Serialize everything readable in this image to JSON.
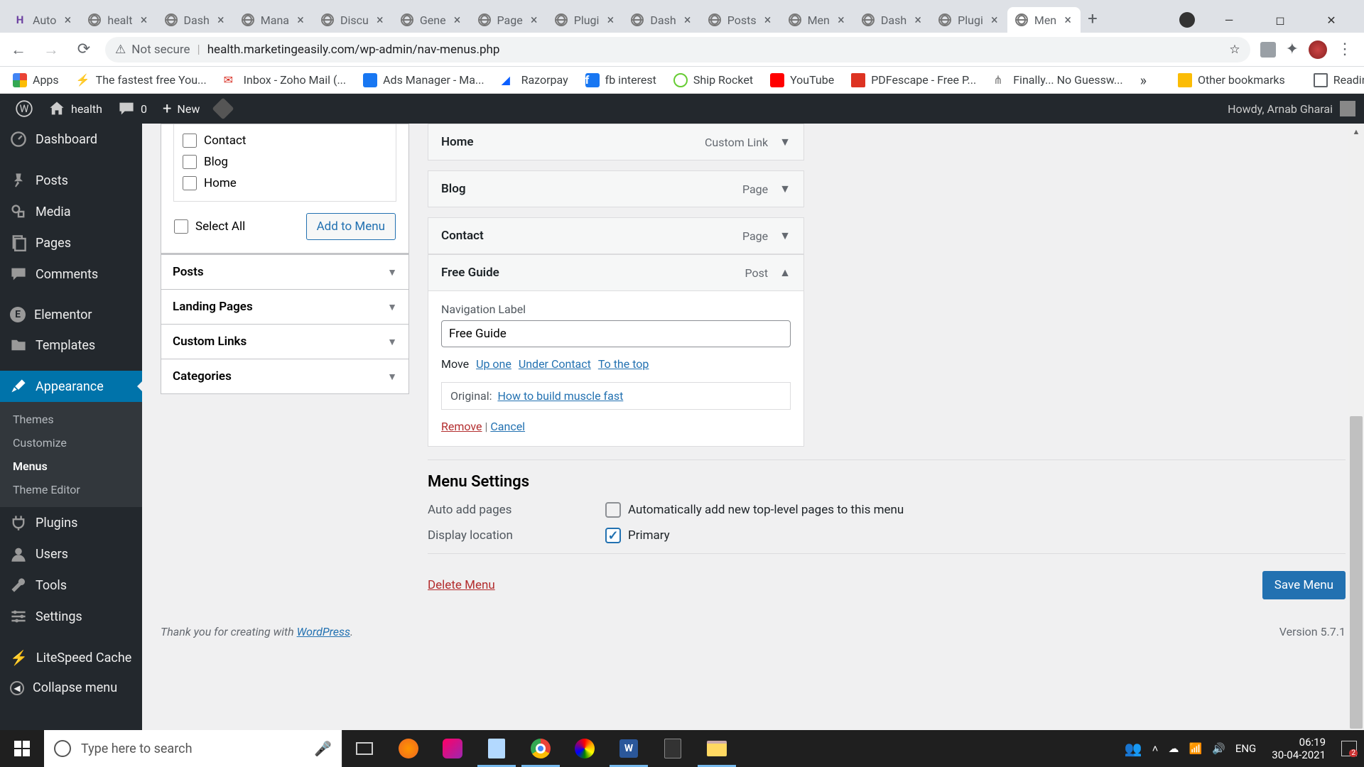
{
  "browser": {
    "tabs": [
      {
        "label": "Auto"
      },
      {
        "label": "healt"
      },
      {
        "label": "Dash"
      },
      {
        "label": "Mana"
      },
      {
        "label": "Discu"
      },
      {
        "label": "Gene"
      },
      {
        "label": "Page"
      },
      {
        "label": "Plugi"
      },
      {
        "label": "Dash"
      },
      {
        "label": "Posts"
      },
      {
        "label": "Men"
      },
      {
        "label": "Dash"
      },
      {
        "label": "Plugi"
      },
      {
        "label": "Men"
      }
    ],
    "url_secure": "Not secure",
    "url": "health.marketingeasily.com/wp-admin/nav-menus.php"
  },
  "bookmarks": {
    "items": [
      "Apps",
      "The fastest free You...",
      "Inbox - Zoho Mail (...",
      "Ads Manager - Ma...",
      "Razorpay",
      "fb interest",
      "Ship Rocket",
      "YouTube",
      "PDFescape - Free P...",
      "Finally... No Guessw..."
    ],
    "other": "Other bookmarks",
    "reading": "Reading list"
  },
  "adminbar": {
    "site": "health",
    "comments": "0",
    "new": "New",
    "howdy": "Howdy, Arnab Gharai"
  },
  "sidebar": {
    "items": [
      {
        "label": "Dashboard"
      },
      {
        "label": "Posts"
      },
      {
        "label": "Media"
      },
      {
        "label": "Pages"
      },
      {
        "label": "Comments"
      },
      {
        "label": "Elementor"
      },
      {
        "label": "Templates"
      },
      {
        "label": "Appearance"
      },
      {
        "label": "Plugins"
      },
      {
        "label": "Users"
      },
      {
        "label": "Tools"
      },
      {
        "label": "Settings"
      },
      {
        "label": "LiteSpeed Cache"
      },
      {
        "label": "Collapse menu"
      }
    ],
    "submenu": [
      "Themes",
      "Customize",
      "Menus",
      "Theme Editor"
    ]
  },
  "pages_box": {
    "items": [
      "Contact",
      "Blog",
      "Home"
    ],
    "select_all": "Select All",
    "add_button": "Add to Menu"
  },
  "accordions": [
    "Posts",
    "Landing Pages",
    "Custom Links",
    "Categories"
  ],
  "menu_items": [
    {
      "title": "Home",
      "type": "Custom Link"
    },
    {
      "title": "Blog",
      "type": "Page"
    },
    {
      "title": "Contact",
      "type": "Page"
    },
    {
      "title": "Free Guide",
      "type": "Post"
    }
  ],
  "expanded": {
    "nav_label_text": "Navigation Label",
    "nav_label_value": "Free Guide",
    "move": "Move",
    "move_links": [
      "Up one",
      "Under Contact",
      "To the top"
    ],
    "original_label": "Original:",
    "original_link": "How to build muscle fast",
    "remove": "Remove",
    "cancel": "Cancel"
  },
  "menu_settings": {
    "heading": "Menu Settings",
    "auto_label": "Auto add pages",
    "auto_text": "Automatically add new top-level pages to this menu",
    "display_label": "Display location",
    "display_text": "Primary",
    "delete": "Delete Menu",
    "save": "Save Menu"
  },
  "footer": {
    "thanks_pre": "Thank you for creating with ",
    "thanks_link": "WordPress",
    "version": "Version 5.7.1"
  },
  "taskbar": {
    "search_placeholder": "Type here to search",
    "lang": "ENG",
    "time": "06:19",
    "date": "30-04-2021"
  }
}
